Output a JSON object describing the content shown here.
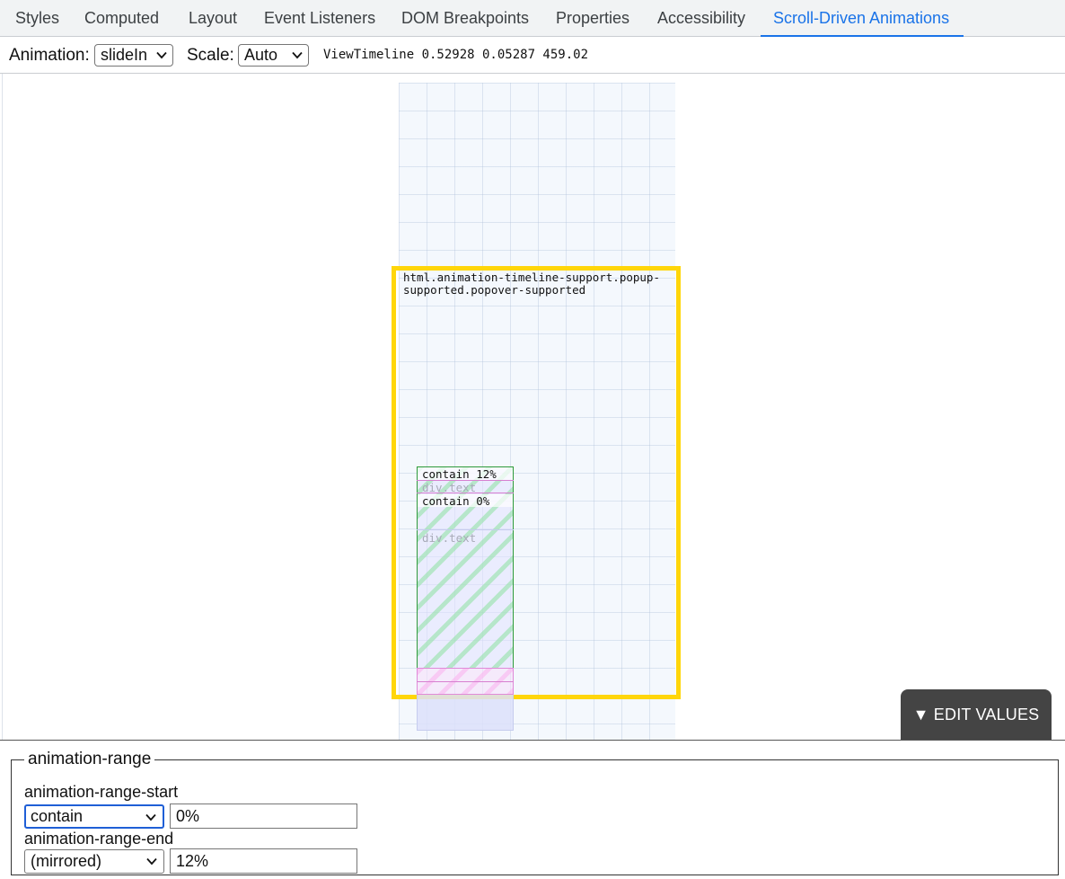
{
  "tabs": [
    {
      "label": "Styles"
    },
    {
      "label": "Computed"
    },
    {
      "label": "Layout"
    },
    {
      "label": "Event Listeners"
    },
    {
      "label": "DOM Breakpoints"
    },
    {
      "label": "Properties"
    },
    {
      "label": "Accessibility"
    },
    {
      "label": "Scroll-Driven Animations",
      "active": true
    }
  ],
  "toolbar": {
    "animation_label": "Animation:",
    "animation_value": "slideIn",
    "scale_label": "Scale:",
    "scale_value": "Auto",
    "timeline_readout": "ViewTimeline 0.52928 0.05287 459.02"
  },
  "visualization": {
    "subject_label": "html.animation-timeline-support.popup-supported.popover-supported",
    "start_mark_label": "contain 12%",
    "end_mark_label": "contain 0%",
    "target_label_1": "div.text",
    "target_label_2": "div.text"
  },
  "edit_button": {
    "label": "▼ EDIT VALUES"
  },
  "range_panel": {
    "legend": "animation-range",
    "start": {
      "label": "animation-range-start",
      "select_value": "contain",
      "input_value": "0%"
    },
    "end": {
      "label": "animation-range-end",
      "select_value": "(mirrored)",
      "input_value": "12%"
    }
  },
  "colors": {
    "accent": "#1a73e8",
    "viewport_border": "#ffd60a",
    "range_border": "#2e9a3a",
    "mirrored_border": "#e08ad8",
    "focus_border": "#1f5fd6"
  }
}
